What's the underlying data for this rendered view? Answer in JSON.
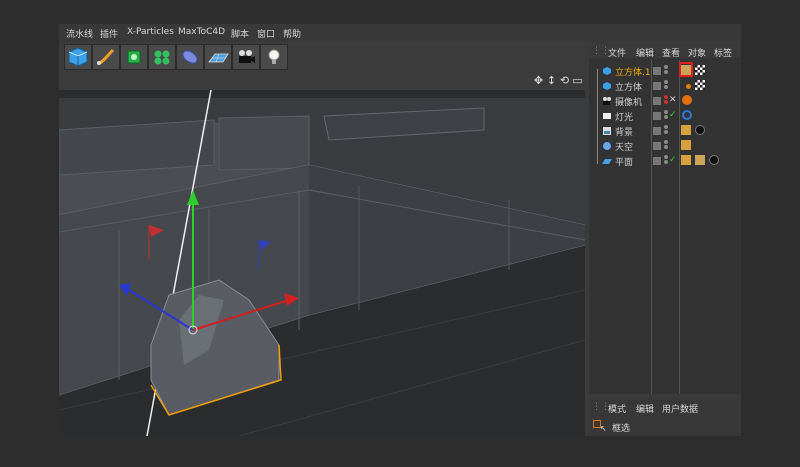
{
  "menu": {
    "items": [
      "流水线",
      "插件",
      "X-Particles",
      "MaxToC4D",
      "脚本",
      "窗口",
      "帮助"
    ]
  },
  "toolbar": {
    "tools": [
      "cube-icon",
      "pen-icon",
      "cloner-icon",
      "deformer-icon",
      "capsule-icon",
      "floor-icon",
      "camera-icon",
      "light-icon"
    ]
  },
  "viewport": {
    "nav_icons": [
      "move-view-icon",
      "zoom-view-icon",
      "rotate-view-icon",
      "maximize-view-icon"
    ]
  },
  "object_manager": {
    "tabs": [
      "文件",
      "编辑",
      "查看",
      "对象",
      "标签"
    ],
    "objects": [
      {
        "name": "立方体.1",
        "selected": true,
        "icon": "cube-icon"
      },
      {
        "name": "立方体",
        "selected": false,
        "icon": "cube-icon"
      },
      {
        "name": "摄像机",
        "selected": false,
        "icon": "camera-icon"
      },
      {
        "name": "灯光",
        "selected": false,
        "icon": "light-icon"
      },
      {
        "name": "背景",
        "selected": false,
        "icon": "background-icon"
      },
      {
        "name": "天空",
        "selected": false,
        "icon": "sky-icon"
      },
      {
        "name": "平面",
        "selected": false,
        "icon": "plane-icon"
      }
    ]
  },
  "attribute_manager": {
    "tabs": [
      "模式",
      "编辑",
      "用户数据"
    ],
    "tool_label": "框选"
  },
  "colors": {
    "selection": "#f0b000",
    "highlight_box": "#e02020"
  }
}
